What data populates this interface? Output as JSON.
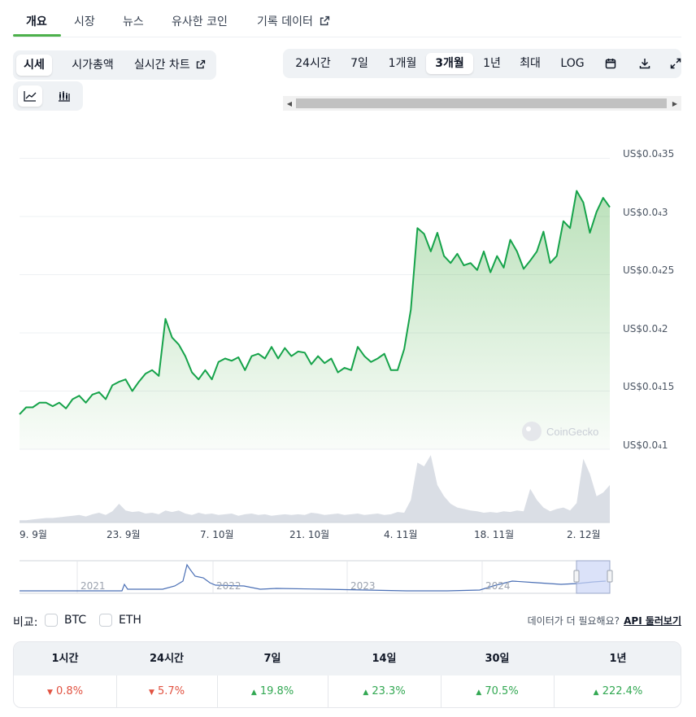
{
  "tabs": [
    {
      "label": "개요"
    },
    {
      "label": "시장"
    },
    {
      "label": "뉴스"
    },
    {
      "label": "유사한 코인"
    },
    {
      "label": "기록 데이터"
    }
  ],
  "view_toggle": {
    "price": "시세",
    "market_cap": "시가총액",
    "live_chart": "실시간 차트"
  },
  "chart_type_icons": [
    "line-chart-icon",
    "candlestick-chart-icon"
  ],
  "ranges": {
    "h24": "24시간",
    "d7": "7일",
    "m1": "1개월",
    "m3": "3개월",
    "y1": "1년",
    "max": "최대",
    "log": "LOG",
    "selected": "3개월"
  },
  "range_icons": [
    "calendar-icon",
    "download-icon",
    "expand-icon"
  ],
  "watermark": "CoinGecko",
  "chart_data": {
    "type": "area",
    "y_ticks": [
      "US$0.0₄35",
      "US$0.0₄3",
      "US$0.0₄25",
      "US$0.0₄2",
      "US$0.0₄15",
      "US$0.0₄1"
    ],
    "x_ticks": [
      "9. 9월",
      "23. 9월",
      "7. 10월",
      "21. 10월",
      "4. 11월",
      "18. 11월",
      "2. 12월"
    ],
    "ylim": [
      1e-05,
      3.5e-05
    ],
    "y_unit": "US$",
    "grid": true,
    "price_color": "#16a34a",
    "volume_color": "#cdd3dc",
    "series": [
      {
        "values": [
          1.3,
          1.36,
          1.36,
          1.4,
          1.4,
          1.37,
          1.4,
          1.35,
          1.43,
          1.46,
          1.4,
          1.47,
          1.49,
          1.43,
          1.55,
          1.58,
          1.6,
          1.5,
          1.58,
          1.65,
          1.68,
          1.63,
          2.12,
          1.96,
          1.9,
          1.8,
          1.66,
          1.6,
          1.68,
          1.6,
          1.75,
          1.78,
          1.76,
          1.79,
          1.68,
          1.8,
          1.82,
          1.78,
          1.88,
          1.78,
          1.87,
          1.8,
          1.84,
          1.83,
          1.73,
          1.8,
          1.74,
          1.78,
          1.66,
          1.7,
          1.68,
          1.88,
          1.8,
          1.75,
          1.78,
          1.82,
          1.68,
          1.68,
          1.86,
          2.2,
          2.9,
          2.85,
          2.7,
          2.86,
          2.66,
          2.6,
          2.68,
          2.58,
          2.6,
          2.54,
          2.7,
          2.52,
          2.66,
          2.56,
          2.8,
          2.7,
          2.55,
          2.62,
          2.7,
          2.87,
          2.6,
          2.66,
          2.96,
          2.9,
          3.22,
          3.12,
          2.86,
          3.04,
          3.16,
          3.08
        ]
      },
      {
        "values": [
          0.3,
          0.3,
          0.4,
          0.5,
          0.6,
          0.6,
          0.7,
          0.8,
          0.9,
          1.0,
          0.8,
          1.1,
          1.3,
          1.0,
          1.5,
          2.5,
          1.6,
          1.4,
          1.5,
          1.2,
          1.3,
          1.1,
          1.6,
          1.4,
          1.6,
          1.2,
          1.0,
          1.3,
          1.1,
          1.2,
          1.0,
          1.1,
          1.2,
          0.9,
          1.1,
          1.2,
          1.0,
          1.1,
          0.9,
          1.0,
          1.1,
          1.0,
          1.1,
          1.0,
          1.3,
          1.2,
          1.0,
          1.1,
          1.2,
          1.0,
          1.1,
          1.2,
          1.0,
          1.1,
          1.2,
          1.0,
          1.1,
          1.4,
          1.3,
          3.0,
          8.0,
          7.5,
          9.0,
          5.0,
          3.5,
          2.5,
          2.0,
          1.8,
          1.6,
          1.5,
          1.3,
          1.4,
          1.3,
          1.5,
          1.4,
          1.6,
          1.5,
          4.5,
          3.0,
          2.0,
          1.5,
          1.8,
          2.0,
          1.6,
          2.6,
          8.5,
          6.5,
          3.5,
          4.0,
          5.0
        ]
      }
    ]
  },
  "navigator": {
    "years": [
      "2021",
      "2022",
      "2023",
      "2024"
    ],
    "series_color": "#4a6fb5"
  },
  "compare": {
    "label": "비교:",
    "btc": "BTC",
    "eth": "ETH"
  },
  "api_note": {
    "question": "데이터가 더 필요해요?",
    "link": "API 둘러보기"
  },
  "performance": {
    "headers": [
      "1시간",
      "24시간",
      "7일",
      "14일",
      "30일",
      "1년"
    ],
    "values": [
      {
        "text": "0.8%",
        "dir": "down"
      },
      {
        "text": "5.7%",
        "dir": "down"
      },
      {
        "text": "19.8%",
        "dir": "up"
      },
      {
        "text": "23.3%",
        "dir": "up"
      },
      {
        "text": "70.5%",
        "dir": "up"
      },
      {
        "text": "222.4%",
        "dir": "up"
      }
    ]
  }
}
